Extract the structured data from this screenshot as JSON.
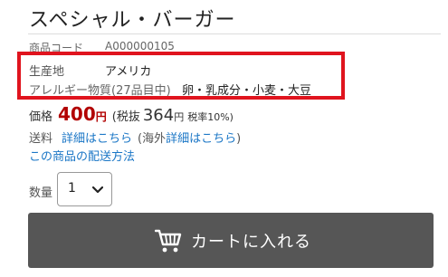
{
  "product": {
    "title": "スペシャル・バーガー",
    "code_label": "商品コード",
    "code_value": "A000000105",
    "origin_label": "生産地",
    "origin_value": "アメリカ",
    "allergy_label": "アレルギー物質(27品目中)",
    "allergy_value": "卵・乳成分・小麦・大豆"
  },
  "price": {
    "label": "価格",
    "amount": "400",
    "yen": "円",
    "tax_excluded_label": "(税抜",
    "tax_excluded_amount": "364",
    "tax_excluded_yen": "円",
    "tax_rate": "税率10%)"
  },
  "shipping": {
    "label": "送料",
    "detail_link": "詳細はこちら",
    "intl_open": "(海外",
    "intl_link": "詳細はこちら",
    "intl_close": ")",
    "delivery_link": "この商品の配送方法"
  },
  "quantity": {
    "label": "数量",
    "selected": "1"
  },
  "cart": {
    "button_label": "カートに入れる",
    "icon": "cart-icon"
  },
  "colors": {
    "highlight": "#e0141e",
    "price": "#b20000",
    "link": "#1a76c6",
    "button": "#565656"
  }
}
